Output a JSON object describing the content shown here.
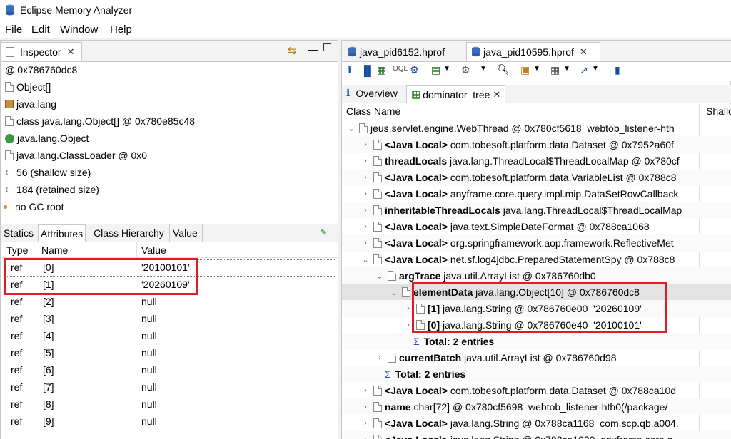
{
  "window": {
    "title": "Eclipse Memory Analyzer"
  },
  "menu": [
    "File",
    "Edit",
    "Window",
    "Help"
  ],
  "inspector": {
    "tab_label": "Inspector",
    "lines": [
      "0x786760dc8",
      "Object[]",
      "java.lang",
      "class java.lang.Object[] @ 0x780e85c48",
      "java.lang.Object",
      "java.lang.ClassLoader @ 0x0",
      "56 (shallow size)",
      "184 (retained size)",
      "no GC root"
    ],
    "subtabs": [
      "Statics",
      "Attributes",
      "Class Hierarchy",
      "Value"
    ],
    "table": {
      "headers": [
        "Type",
        "Name",
        "Value"
      ],
      "rows": [
        [
          "ref",
          "[0]",
          "'20100101'"
        ],
        [
          "ref",
          "[1]",
          "'20260109'"
        ],
        [
          "ref",
          "[2]",
          "null"
        ],
        [
          "ref",
          "[3]",
          "null"
        ],
        [
          "ref",
          "[4]",
          "null"
        ],
        [
          "ref",
          "[5]",
          "null"
        ],
        [
          "ref",
          "[6]",
          "null"
        ],
        [
          "ref",
          "[7]",
          "null"
        ],
        [
          "ref",
          "[8]",
          "null"
        ],
        [
          "ref",
          "[9]",
          "null"
        ]
      ]
    }
  },
  "editor": {
    "tabs": [
      "java_pid6152.hprof",
      "java_pid10595.hprof"
    ],
    "subtabs": [
      "Overview",
      "dominator_tree"
    ],
    "columns": [
      "Class Name",
      "Shallo"
    ],
    "tree": [
      {
        "bold": "",
        "text": "jeus.servlet.engine.WebThread @ 0x780cf5618  webtob_listener-hth"
      },
      {
        "bold": "<Java Local>",
        "text": " com.tobesoft.platform.data.Dataset @ 0x7952a60f"
      },
      {
        "bold": "threadLocals",
        "text": " java.lang.ThreadLocal$ThreadLocalMap @ 0x780cf"
      },
      {
        "bold": "<Java Local>",
        "text": " com.tobesoft.platform.data.VariableList @ 0x788c8"
      },
      {
        "bold": "<Java Local>",
        "text": " anyframe.core.query.impl.mip.DataSetRowCallback"
      },
      {
        "bold": "inheritableThreadLocals",
        "text": " java.lang.ThreadLocal$ThreadLocalMap"
      },
      {
        "bold": "<Java Local>",
        "text": " java.text.SimpleDateFormat @ 0x788ca1068"
      },
      {
        "bold": "<Java Local>",
        "text": " org.springframework.aop.framework.ReflectiveMet"
      },
      {
        "bold": "<Java Local>",
        "text": " net.sf.log4jdbc.PreparedStatementSpy @ 0x788c8"
      },
      {
        "bold": "argTrace",
        "text": " java.util.ArrayList @ 0x786760db0"
      },
      {
        "bold": "elementData",
        "text": " java.lang.Object[10] @ 0x786760dc8"
      },
      {
        "bold": "[1]",
        "text": " java.lang.String @ 0x786760e00  '20260109'"
      },
      {
        "bold": "[0]",
        "text": " java.lang.String @ 0x786760e40  '20100101'"
      },
      {
        "bold": "Total: 2 entries",
        "text": ""
      },
      {
        "bold": "currentBatch",
        "text": " java.util.ArrayList @ 0x786760d98"
      },
      {
        "bold": "Total: 2 entries",
        "text": ""
      },
      {
        "bold": "<Java Local>",
        "text": " com.tobesoft.platform.data.Dataset @ 0x788ca10d"
      },
      {
        "bold": "name",
        "text": " char[72] @ 0x780cf5698  webtob_listener-hth0(/package/"
      },
      {
        "bold": "<Java Local>",
        "text": " java.lang.String @ 0x788ca1168  com.scp.qb.a004."
      },
      {
        "bold": "<Java Local>",
        "text": " java.lang.String @ 0x788ca1020  anyframe.core.q"
      }
    ]
  },
  "colors": {
    "highlight": "#e01b24",
    "selection": "#e3e3e3"
  }
}
